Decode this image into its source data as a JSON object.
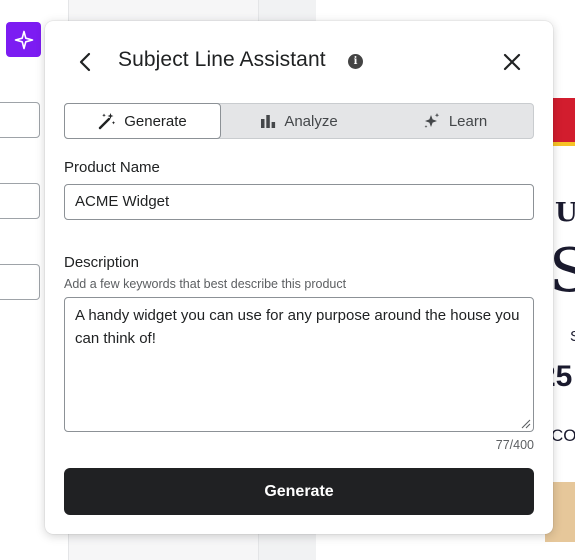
{
  "background": {
    "ai_button_icon": "sparkle-icon",
    "email_preview_fragments": [
      "U",
      "S",
      "S",
      "25",
      "CO"
    ]
  },
  "panel": {
    "title": "Subject Line Assistant",
    "info_icon": "info-icon",
    "tabs": [
      {
        "label": "Generate",
        "icon": "magic-wand-icon",
        "active": true
      },
      {
        "label": "Analyze",
        "icon": "bar-chart-icon",
        "active": false
      },
      {
        "label": "Learn",
        "icon": "sparkles-icon",
        "active": false
      }
    ],
    "product_name": {
      "label": "Product Name",
      "value": "ACME Widget"
    },
    "description": {
      "label": "Description",
      "help": "Add a few keywords that best describe this product",
      "value": "A handy widget you can use for any purpose around the house you can think of!",
      "counter": "77/400"
    },
    "generate_label": "Generate"
  },
  "colors": {
    "accent_purple": "#7c1cf2",
    "button_dark": "#202123",
    "email_red": "#d21d2e",
    "email_yellow": "#f7c326"
  }
}
